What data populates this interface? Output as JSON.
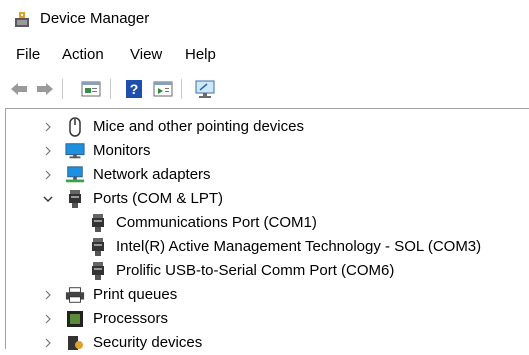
{
  "window": {
    "title": "Device Manager",
    "icon": "device-manager-icon"
  },
  "menu": {
    "items": [
      "File",
      "Action",
      "View",
      "Help"
    ]
  },
  "toolbar": {
    "buttons": [
      "back-icon",
      "forward-icon",
      "properties-sheet-icon",
      "help-icon",
      "update-driver-icon",
      "scan-monitor-icon"
    ]
  },
  "tree": {
    "categories": [
      {
        "label": "Mice and other pointing devices",
        "expanded": false,
        "icon": "mouse-icon"
      },
      {
        "label": "Monitors",
        "expanded": false,
        "icon": "monitor-icon"
      },
      {
        "label": "Network adapters",
        "expanded": false,
        "icon": "network-adapter-icon"
      },
      {
        "label": "Ports (COM & LPT)",
        "expanded": true,
        "icon": "port-icon",
        "children": [
          {
            "label": "Communications Port (COM1)",
            "icon": "port-icon"
          },
          {
            "label": "Intel(R) Active Management Technology - SOL (COM3)",
            "icon": "port-icon"
          },
          {
            "label": "Prolific USB-to-Serial Comm Port (COM6)",
            "icon": "port-icon"
          }
        ]
      },
      {
        "label": "Print queues",
        "expanded": false,
        "icon": "printer-icon"
      },
      {
        "label": "Processors",
        "expanded": false,
        "icon": "processor-icon"
      },
      {
        "label": "Security devices",
        "expanded": false,
        "icon": "security-device-icon"
      }
    ]
  }
}
